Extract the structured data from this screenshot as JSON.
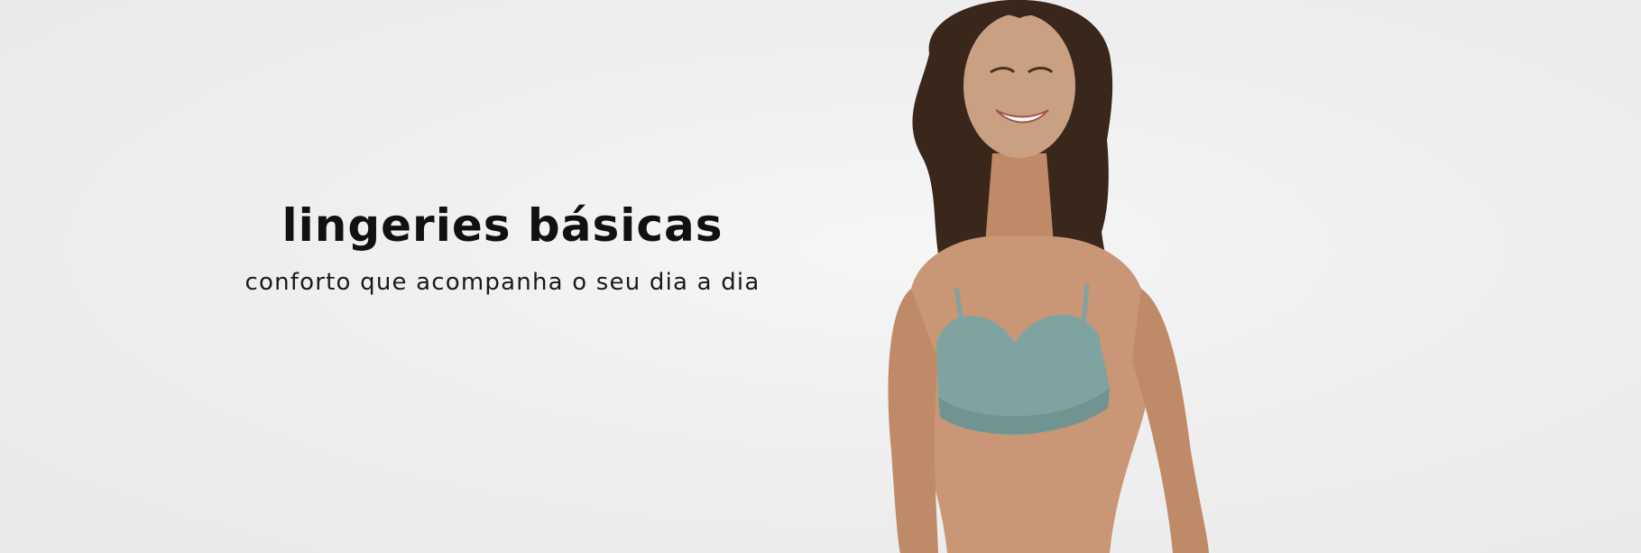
{
  "banner": {
    "headline": "lingeries básicas",
    "subheadline": "conforto que acompanha o seu dia a dia"
  },
  "colors": {
    "background": "#efefef",
    "text": "#111111",
    "bra": "#7fa3a0",
    "skin": "#c99676",
    "hair": "#3a271c"
  }
}
